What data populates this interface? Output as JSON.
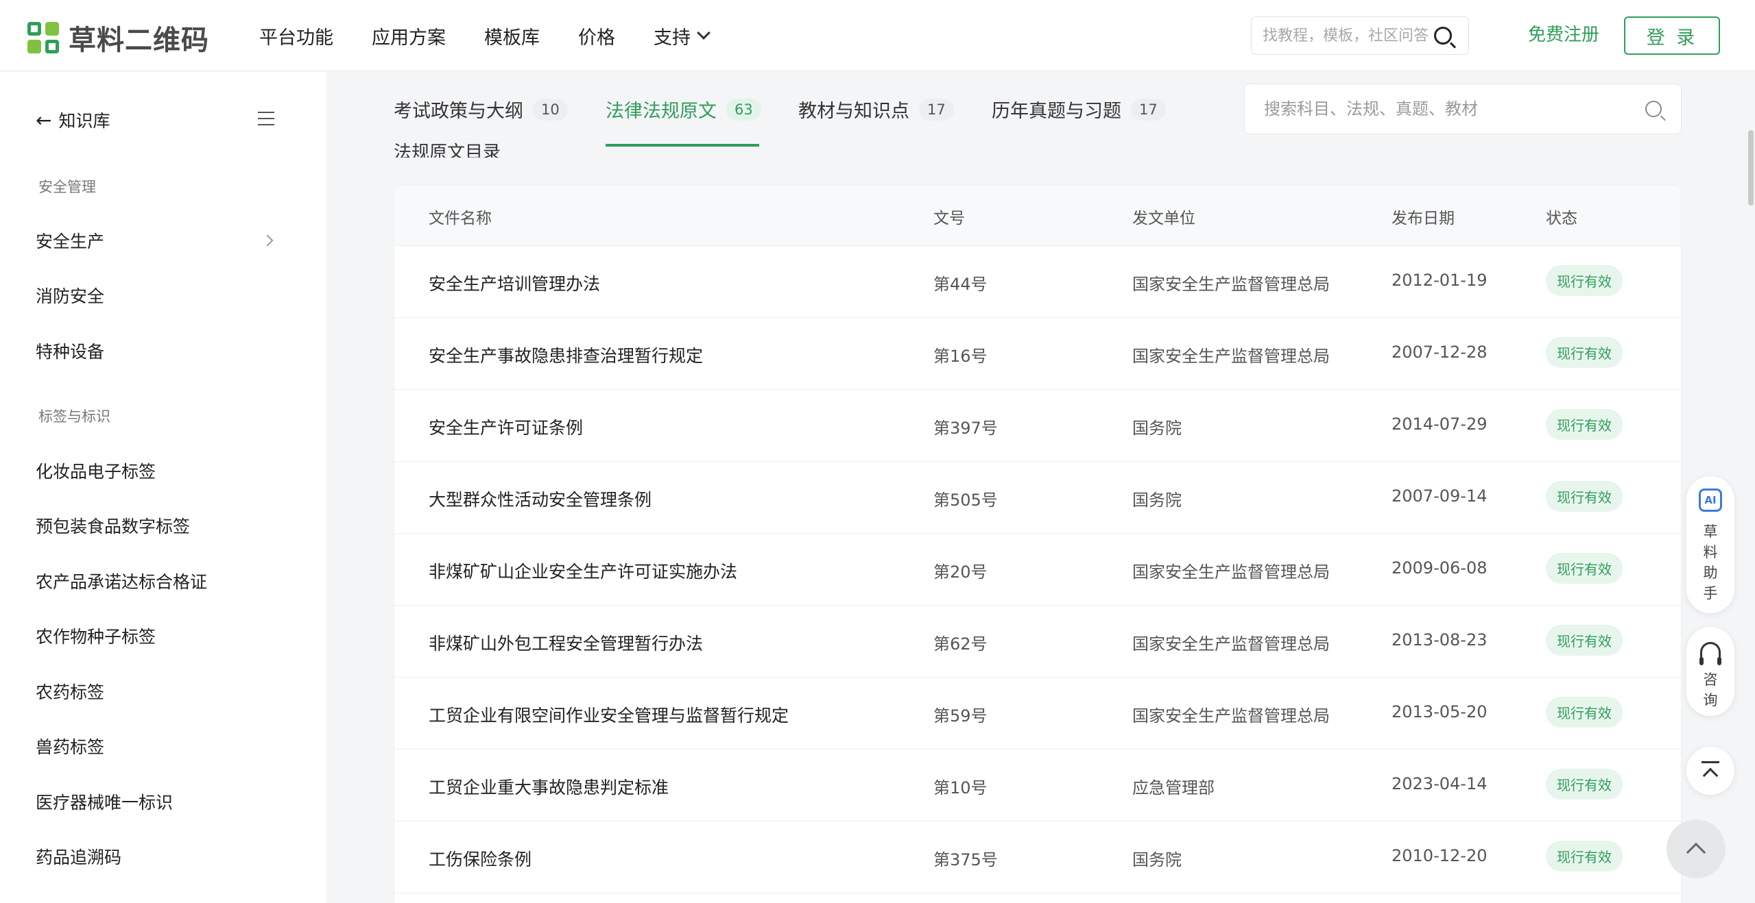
{
  "header": {
    "logo_text": "草料二维码",
    "nav": [
      {
        "label": "平台功能"
      },
      {
        "label": "应用方案"
      },
      {
        "label": "模板库"
      },
      {
        "label": "价格"
      },
      {
        "label": "支持"
      }
    ],
    "search_placeholder": "找教程，模板，社区问答",
    "register_label": "免费注册",
    "login_label": "登 录"
  },
  "sidebar": {
    "back_label": "知识库",
    "sections": [
      {
        "title": "安全管理",
        "items": [
          "安全生产",
          "消防安全",
          "特种设备"
        ]
      },
      {
        "title": "标签与标识",
        "items": [
          "化妆品电子标签",
          "预包装食品数字标签",
          "农产品承诺达标合格证",
          "农作物种子标签",
          "农药标签",
          "兽药标签",
          "医疗器械唯一标识",
          "药品追溯码"
        ]
      }
    ]
  },
  "tabs": [
    {
      "label": "考试政策与大纲",
      "count": "10"
    },
    {
      "label": "法律法规原文",
      "count": "63",
      "active": true
    },
    {
      "label": "教材与知识点",
      "count": "17"
    },
    {
      "label": "历年真题与习题",
      "count": "17"
    }
  ],
  "main_search_placeholder": "搜索科目、法规、真题、教材",
  "section_heading": "法规原文目录",
  "table": {
    "columns": [
      "文件名称",
      "文号",
      "发文单位",
      "发布日期",
      "状态"
    ],
    "rows": [
      {
        "name": "安全生产培训管理办法",
        "doc_no": "第44号",
        "issuer": "国家安全生产监督管理总局",
        "date": "2012-01-19",
        "status": "现行有效"
      },
      {
        "name": "安全生产事故隐患排查治理暂行规定",
        "doc_no": "第16号",
        "issuer": "国家安全生产监督管理总局",
        "date": "2007-12-28",
        "status": "现行有效"
      },
      {
        "name": "安全生产许可证条例",
        "doc_no": "第397号",
        "issuer": "国务院",
        "date": "2014-07-29",
        "status": "现行有效"
      },
      {
        "name": "大型群众性活动安全管理条例",
        "doc_no": "第505号",
        "issuer": "国务院",
        "date": "2007-09-14",
        "status": "现行有效"
      },
      {
        "name": "非煤矿矿山企业安全生产许可证实施办法",
        "doc_no": "第20号",
        "issuer": "国家安全生产监督管理总局",
        "date": "2009-06-08",
        "status": "现行有效"
      },
      {
        "name": "非煤矿山外包工程安全管理暂行办法",
        "doc_no": "第62号",
        "issuer": "国家安全生产监督管理总局",
        "date": "2013-08-23",
        "status": "现行有效"
      },
      {
        "name": "工贸企业有限空间作业安全管理与监督暂行规定",
        "doc_no": "第59号",
        "issuer": "国家安全生产监督管理总局",
        "date": "2013-05-20",
        "status": "现行有效"
      },
      {
        "name": "工贸企业重大事故隐患判定标准",
        "doc_no": "第10号",
        "issuer": "应急管理部",
        "date": "2023-04-14",
        "status": "现行有效"
      },
      {
        "name": "工伤保险条例",
        "doc_no": "第375号",
        "issuer": "国务院",
        "date": "2010-12-20",
        "status": "现行有效"
      }
    ]
  },
  "float": {
    "ai_icon_text": "AI",
    "ai_label": "草料助手",
    "consult_label": "咨询"
  },
  "icons": [
    "search-icon",
    "menu-icon",
    "chevron-right-icon",
    "chevron-down-icon",
    "ai-assistant-icon",
    "headset-icon",
    "to-top-icon"
  ],
  "colors": {
    "brand": "#2f9e5a",
    "accent_ai": "#3a7be0"
  }
}
